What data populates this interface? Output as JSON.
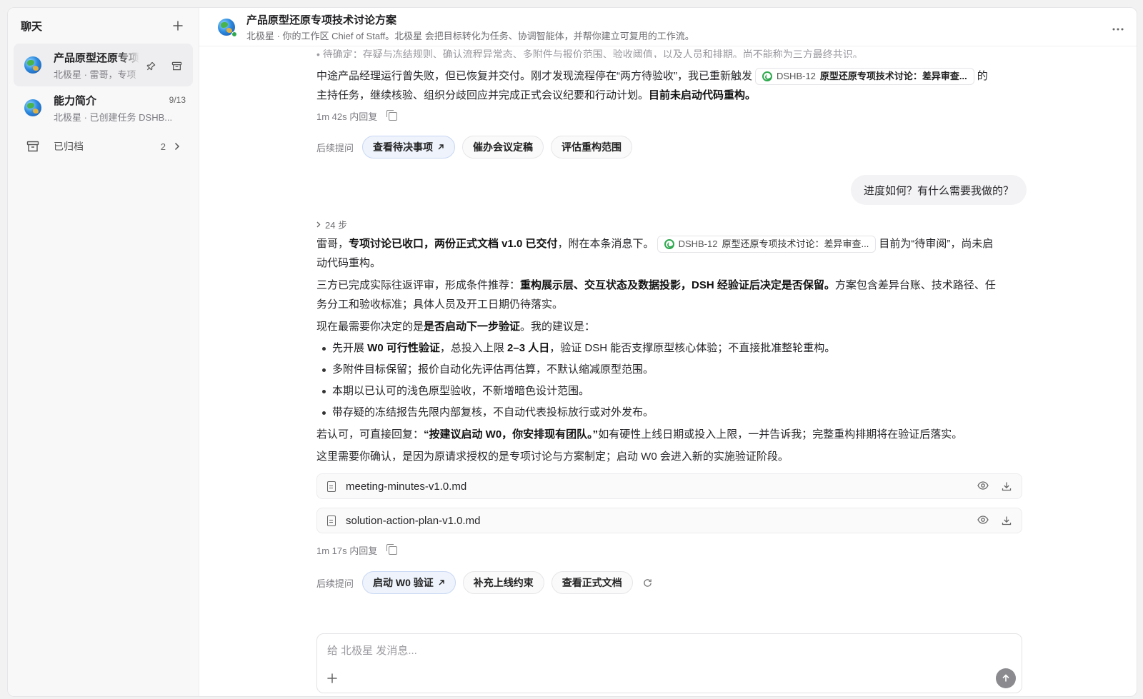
{
  "sidebar": {
    "title": "聊天",
    "chats": [
      {
        "title": "产品原型还原专项",
        "subtitle": "北极星 · 雷哥，专项"
      },
      {
        "title": "能力简介",
        "date": "9/13",
        "subtitle": "北极星 · 已创建任务 DSHB..."
      }
    ],
    "archived": {
      "label": "已归档",
      "count": "2"
    }
  },
  "header": {
    "title": "产品原型还原专项技术讨论方案",
    "subtitle": "北极星 · 你的工作区 Chief of Staff。北极星 会把目标转化为任务、协调智能体，并帮你建立可复用的工作流。"
  },
  "msg1": {
    "clipped_bullet": "待确定：存疑与冻结规则、确认流程异常态、多附件与报价范围、验收阈值，以及人员和排期。尚不能称为三方最终共识。",
    "p_a": "中途产品经理运行曾失败，但已恢复并交付。刚才发现流程停在“两方待验收”，我已重新触发",
    "chip_id": "DSHB-12",
    "chip_name": "原型还原专项技术讨论：差异审查...",
    "p_b": "的",
    "p_c": "主持任务，继续核验、组织分歧回应并完成正式会议纪要和行动计划。",
    "p_c_bold": "目前未启动代码重构。",
    "meta": "1m 42s 内回复",
    "fu_label": "后续提问",
    "followups": [
      "查看待决事项",
      "催办会议定稿",
      "评估重构范围"
    ]
  },
  "user_msg": "进度如何？有什么需要我做的？",
  "msg2": {
    "steps": "24 步",
    "p1_a": "雷哥，",
    "p1_b": "专项讨论已收口，两份正式文档 v1.0 已交付",
    "p1_c": "，附在本条消息下。",
    "chip_id": "DSHB-12",
    "chip_name": "原型还原专项技术讨论：差异审查...",
    "p1_d": "目前为“待审阅”，尚未启",
    "p1_e": "动代码重构。",
    "p2_a": "三方已完成实际往返评审，形成条件推荐：",
    "p2_b": "重构展示层、交互状态及数据投影，DSH 经验证后决定是否保留。",
    "p2_c": "方案包含差异台账、技术路径、任",
    "p2_d": "务分工和验收标准；具体人员及开工日期仍待落实。",
    "p3_a": "现在最需要你决定的是",
    "p3_b": "是否启动下一步验证",
    "p3_c": "。我的建议是：",
    "b1_a": "先开展 ",
    "b1_b": "W0 可行性验证",
    "b1_c": "，总投入上限 ",
    "b1_d": "2–3 人日",
    "b1_e": "，验证 DSH 能否支撑原型核心体验；不直接批准整轮重构。",
    "b2": "多附件目标保留；报价自动化先评估再估算，不默认缩减原型范围。",
    "b3": "本期以已认可的浅色原型验收，不新增暗色设计范围。",
    "b4": "带存疑的冻结报告先限内部复核，不自动代表投标放行或对外发布。",
    "p4_a": "若认可，可直接回复：",
    "p4_b": "“按建议启动 W0，你安排现有团队。”",
    "p4_c": "如有硬性上线日期或投入上限，一并告诉我；完整重构排期将在验证后落实。",
    "p5": "这里需要你确认，是因为原请求授权的是专项讨论与方案制定；启动 W0 会进入新的实施验证阶段。",
    "files": [
      "meeting-minutes-v1.0.md",
      "solution-action-plan-v1.0.md"
    ],
    "meta": "1m 17s 内回复",
    "fu_label": "后续提问",
    "followups": [
      "启动 W0 验证",
      "补充上线约束",
      "查看正式文档"
    ]
  },
  "composer": {
    "placeholder": "给 北极星 发消息..."
  }
}
